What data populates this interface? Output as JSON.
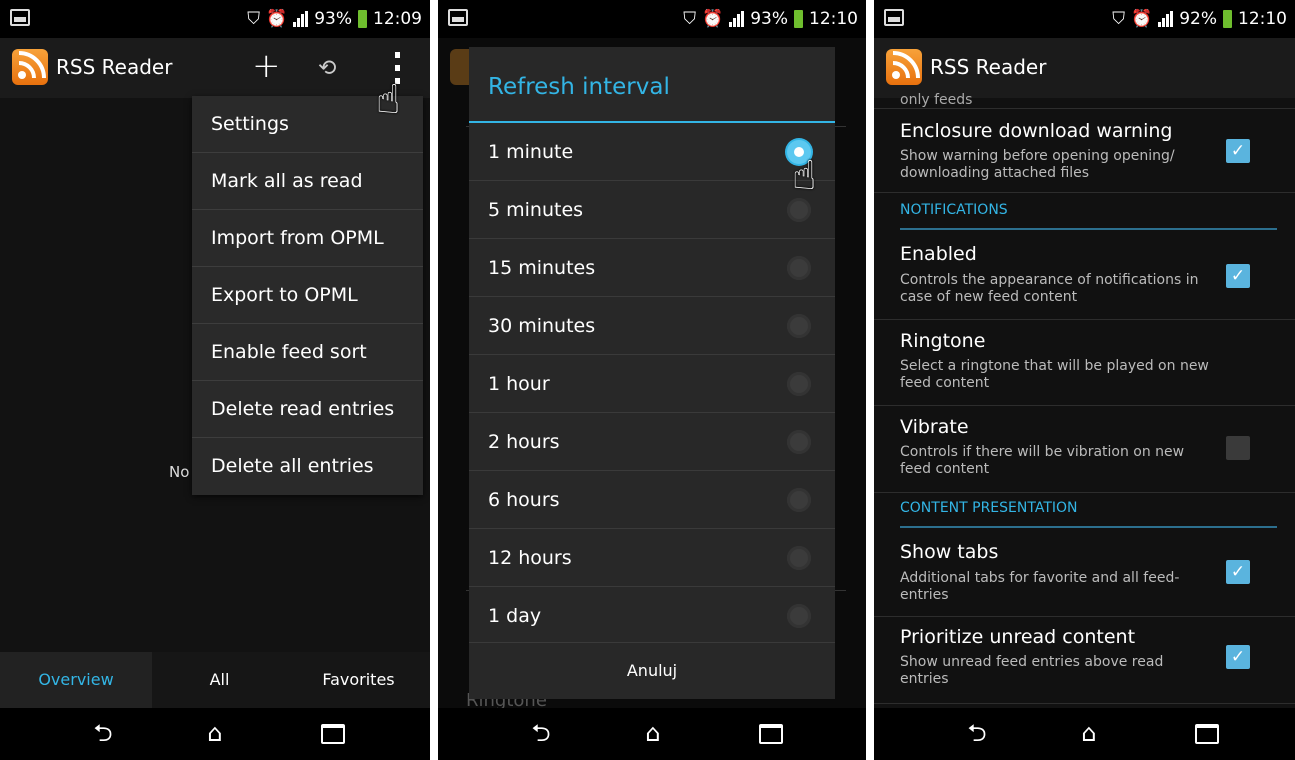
{
  "status_bars": [
    {
      "battery": "93%",
      "time": "12:09"
    },
    {
      "battery": "93%",
      "time": "12:10"
    },
    {
      "battery": "92%",
      "time": "12:10"
    }
  ],
  "app": {
    "title": "RSS Reader"
  },
  "screen1": {
    "menu_items": [
      "Settings",
      "Mark all as read",
      "Import from OPML",
      "Export to OPML",
      "Enable feed sort",
      "Delete read entries",
      "Delete all entries"
    ],
    "partial_text": "No",
    "tabs": [
      "Overview",
      "All",
      "Favorites"
    ],
    "active_tab": "Overview"
  },
  "screen2": {
    "dialog_title": "Refresh interval",
    "options": [
      "1 minute",
      "5 minutes",
      "15 minutes",
      "30 minutes",
      "1 hour",
      "2 hours",
      "6 hours",
      "12 hours",
      "1 day"
    ],
    "selected_option": "1 minute",
    "cancel_label": "Anuluj",
    "background_text": "Ringtone"
  },
  "screen3": {
    "clipped_text": "only  feeds",
    "enclosure": {
      "title": "Enclosure download warning",
      "summary": "Show warning before opening opening/ downloading attached files",
      "checked": true
    },
    "category_notifications": "NOTIFICATIONS",
    "enabled": {
      "title": "Enabled",
      "summary": "Controls the appearance of notifications in case of new feed content",
      "checked": true
    },
    "ringtone": {
      "title": "Ringtone",
      "summary": "Select a ringtone that will be played on new feed content"
    },
    "vibrate": {
      "title": "Vibrate",
      "summary": "Controls if there will be vibration on new feed content",
      "checked": false
    },
    "category_content": "CONTENT PRESENTATION",
    "show_tabs": {
      "title": "Show tabs",
      "summary": "Additional tabs for favorite and all feed-entries",
      "checked": true
    },
    "prioritize": {
      "title": "Prioritize unread content",
      "summary": "Show unread feed entries above read entries",
      "checked": true
    }
  },
  "colors": {
    "accent": "#33b5e5",
    "checkbox": "#5ab4de",
    "logo": "#f28a1e"
  },
  "icons": [
    "image-icon",
    "antivirus-icon",
    "alarm-icon",
    "signal-icon",
    "battery-icon",
    "add-icon",
    "rotate-icon",
    "overflow-menu-icon",
    "pointer-hand-icon",
    "back-icon",
    "home-icon",
    "recent-apps-icon",
    "rss-logo-icon"
  ]
}
